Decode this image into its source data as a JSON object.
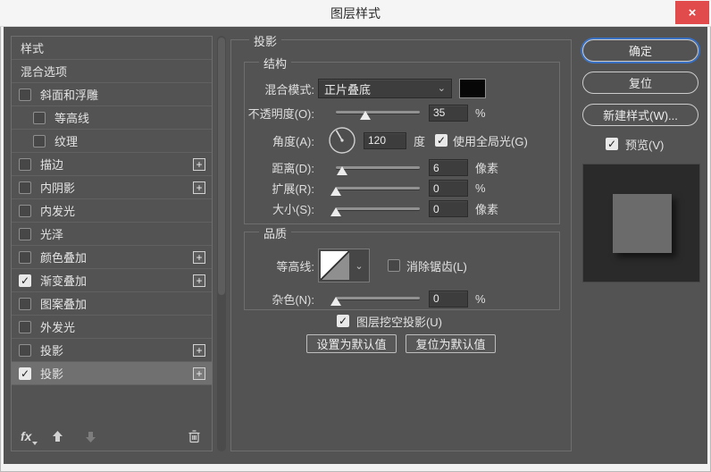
{
  "window": {
    "title": "图层样式",
    "close": "×"
  },
  "icons": {
    "check": "✓",
    "chevron_down": "⌄"
  },
  "colors": {
    "dialog_bg": "#535353",
    "titlebar_bg": "#f5f5f5",
    "close_red": "#e14b4b",
    "focus_blue": "#3a70c1",
    "selected_row": "#707070",
    "blend_swatch": "#070707",
    "preview_square": "#6b6b6b"
  },
  "sidebar": {
    "items": [
      {
        "label": "样式"
      },
      {
        "label": "混合选项"
      },
      {
        "label": "斜面和浮雕",
        "checked": false
      },
      {
        "label": "等高线",
        "checked": false,
        "indent": true
      },
      {
        "label": "纹理",
        "checked": false,
        "indent": true
      },
      {
        "label": "描边",
        "checked": false,
        "plus": "+"
      },
      {
        "label": "内阴影",
        "checked": false,
        "plus": "+"
      },
      {
        "label": "内发光",
        "checked": false
      },
      {
        "label": "光泽",
        "checked": false
      },
      {
        "label": "颜色叠加",
        "checked": false,
        "plus": "+"
      },
      {
        "label": "渐变叠加",
        "checked": true,
        "plus": "+"
      },
      {
        "label": "图案叠加",
        "checked": false
      },
      {
        "label": "外发光",
        "checked": false
      },
      {
        "label": "投影",
        "checked": false,
        "plus": "+"
      },
      {
        "label": "投影",
        "checked": true,
        "plus": "+",
        "selected": true
      }
    ],
    "footer": {
      "fx": "fx"
    }
  },
  "panel": {
    "title": "投影",
    "structure": {
      "legend": "结构",
      "blend_label": "混合模式:",
      "blend_value": "正片叠底",
      "opacity_label": "不透明度(O):",
      "opacity_value": "35",
      "opacity_unit": "%",
      "opacity_thumb": "left:35%",
      "angle_label": "角度(A):",
      "angle_value": "120",
      "angle_unit": "度",
      "global_light_label": "使用全局光(G)",
      "global_light_checked": true,
      "distance_label": "距离(D):",
      "distance_value": "6",
      "distance_unit": "像素",
      "distance_thumb": "left:7%",
      "spread_label": "扩展(R):",
      "spread_value": "0",
      "spread_unit": "%",
      "spread_thumb": "left:0%",
      "size_label": "大小(S):",
      "size_value": "0",
      "size_unit": "像素",
      "size_thumb": "left:0%"
    },
    "quality": {
      "legend": "品质",
      "contour_label": "等高线:",
      "antialias_label": "消除锯齿(L)",
      "antialias_checked": false,
      "noise_label": "杂色(N):",
      "noise_value": "0",
      "noise_unit": "%",
      "noise_thumb": "left:0%"
    },
    "knockout_label": "图层挖空投影(U)",
    "knockout_checked": true,
    "set_default": "设置为默认值",
    "reset_default": "复位为默认值"
  },
  "actions": {
    "ok": "确定",
    "reset": "复位",
    "new_style": "新建样式(W)...",
    "preview_label": "预览(V)",
    "preview_checked": true
  }
}
